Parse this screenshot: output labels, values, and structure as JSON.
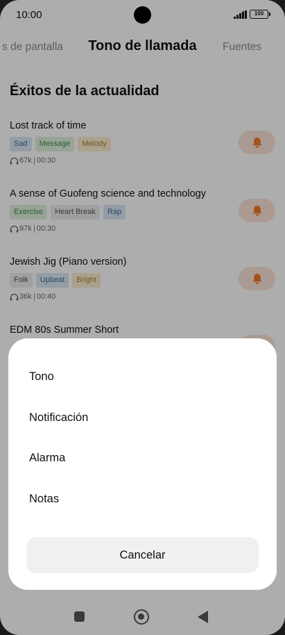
{
  "status_bar": {
    "time": "10:00",
    "battery": "100",
    "icons": [
      "signal-icon",
      "battery-icon"
    ]
  },
  "header": {
    "tab_left": "s de pantalla",
    "title": "Tono de llamada",
    "tab_right": "Fuentes"
  },
  "section": {
    "title": "Éxitos de la actualidad"
  },
  "songs": [
    {
      "title": "Lost track of time",
      "tags": [
        "Sad",
        "Message",
        "Melody"
      ],
      "plays": "67k",
      "duration": "00:30"
    },
    {
      "title": "A sense of Guofeng science and technology",
      "tags": [
        "Exercise",
        "Heart Break",
        "Rap"
      ],
      "plays": "97k",
      "duration": "00:30"
    },
    {
      "title": "Jewish Jig (Piano version)",
      "tags": [
        "Folk",
        "Upbeat",
        "Bright"
      ],
      "plays": "36k",
      "duration": "00:40"
    },
    {
      "title": "EDM 80s Summer Short"
    }
  ],
  "sheet": {
    "options": [
      "Tono",
      "Notificación",
      "Alarma",
      "Notas"
    ],
    "cancel": "Cancelar"
  },
  "colors": {
    "accent": "#f0792a",
    "bell_bg": "#fde3d7",
    "sheet_bg": "#ffffff",
    "overlay": "rgba(0,0,0,0.32)"
  }
}
